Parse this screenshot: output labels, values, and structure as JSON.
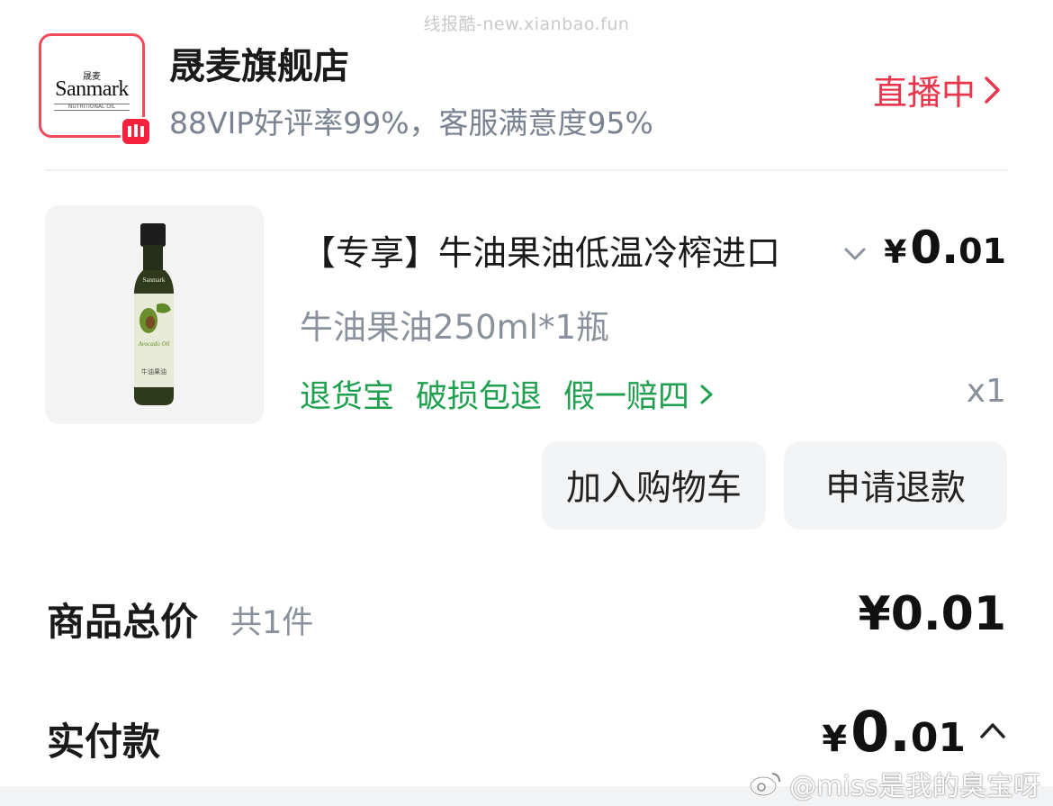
{
  "watermark_top": "线报酷-new.xianbao.fun",
  "store": {
    "logo": {
      "cn": "晟麦",
      "en": "Sanmark",
      "sub": "NUTRITIONAL OIL"
    },
    "name": "晟麦旗舰店",
    "rating": "88VIP好评率99%，客服满意度95%",
    "live_label": "直播中"
  },
  "product": {
    "title": "【专享】牛油果油低温冷榨进口",
    "price_symbol": "¥",
    "price_int": "0.",
    "price_dec": "01",
    "sku": "牛油果油250ml*1瓶",
    "service_tags": [
      "退货宝",
      "破损包退",
      "假一赔四"
    ],
    "quantity": "x1",
    "bottle": {
      "brand": "Sanmark",
      "name_en": "Avocado Oil",
      "name_cn": "牛油果油"
    }
  },
  "buttons": {
    "add_to_cart": "加入购物车",
    "refund": "申请退款"
  },
  "totals": {
    "goods_label": "商品总价",
    "goods_count": "共1件",
    "goods_price": "¥0.01",
    "paid_label": "实付款",
    "paid_symbol": "¥",
    "paid_int": "0.",
    "paid_dec": "01"
  },
  "weibo_watermark": "@miss是我的臭宝呀",
  "colors": {
    "live_red": "#e8354b",
    "service_green": "#1fa04e",
    "muted_gray": "#8a919d",
    "button_bg": "#f3f4f6"
  }
}
